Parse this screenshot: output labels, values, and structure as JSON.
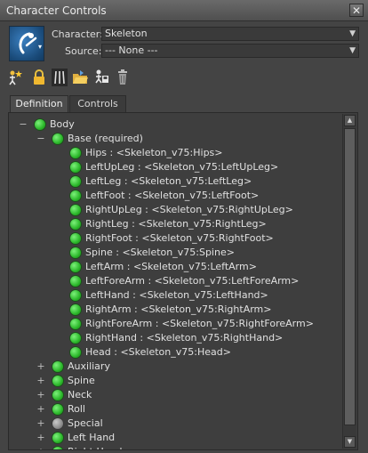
{
  "window": {
    "title": "Character Controls",
    "close_glyph": "✕"
  },
  "character_icon": {
    "icon": "character-logo-icon",
    "dropdown_glyph": "▾"
  },
  "character_field": {
    "label": "Character:",
    "value": "Skeleton"
  },
  "source_field": {
    "label": "Source:",
    "value": "--- None ---"
  },
  "toolbar": {
    "icons": [
      "create-character-icon",
      "lock-icon",
      "skeleton-icon",
      "open-folder-icon",
      "save-definition-icon",
      "delete-icon"
    ]
  },
  "tabs": [
    {
      "label": "Definition",
      "active": true
    },
    {
      "label": "Controls",
      "active": false
    }
  ],
  "tree": {
    "root": {
      "label": "Body",
      "expanded": true,
      "status": "green"
    },
    "base": {
      "label": "Base (required)",
      "expanded": true,
      "status": "green"
    },
    "base_items": [
      "Hips : <Skeleton_v75:Hips>",
      "LeftUpLeg : <Skeleton_v75:LeftUpLeg>",
      "LeftLeg : <Skeleton_v75:LeftLeg>",
      "LeftFoot : <Skeleton_v75:LeftFoot>",
      "RightUpLeg : <Skeleton_v75:RightUpLeg>",
      "RightLeg : <Skeleton_v75:RightLeg>",
      "RightFoot : <Skeleton_v75:RightFoot>",
      "Spine : <Skeleton_v75:Spine>",
      "LeftArm : <Skeleton_v75:LeftArm>",
      "LeftForeArm : <Skeleton_v75:LeftForeArm>",
      "LeftHand : <Skeleton_v75:LeftHand>",
      "RightArm : <Skeleton_v75:RightArm>",
      "RightForeArm : <Skeleton_v75:RightForeArm>",
      "RightHand : <Skeleton_v75:RightHand>",
      "Head : <Skeleton_v75:Head>"
    ],
    "groups": [
      {
        "label": "Auxiliary",
        "status": "green"
      },
      {
        "label": "Spine",
        "status": "green"
      },
      {
        "label": "Neck",
        "status": "green"
      },
      {
        "label": "Roll",
        "status": "green"
      },
      {
        "label": "Special",
        "status": "gray"
      },
      {
        "label": "Left Hand",
        "status": "green"
      },
      {
        "label": "Right Hand",
        "status": "green"
      }
    ],
    "collapse_glyph": "−",
    "expand_glyph": "+"
  },
  "scrollbar": {
    "up_glyph": "▲",
    "down_glyph": "▼"
  }
}
